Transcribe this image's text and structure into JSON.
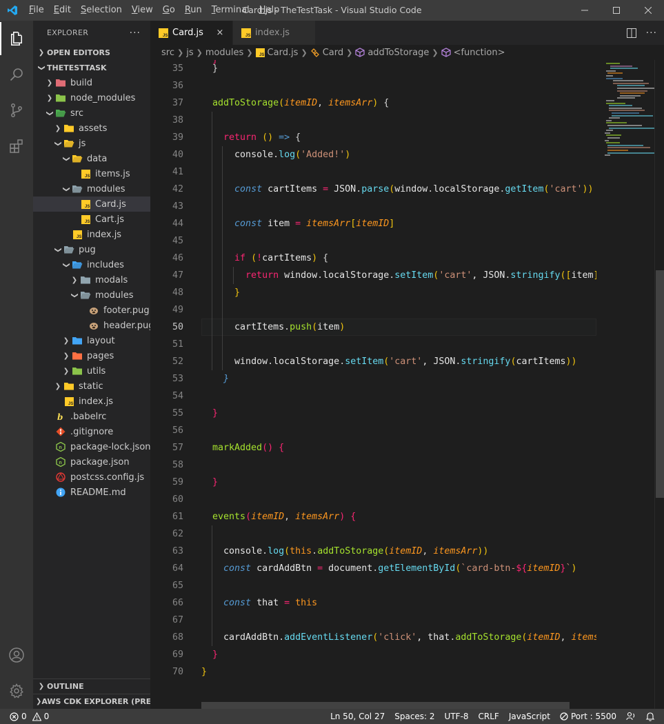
{
  "window": {
    "title": "Card.js - TheTestTask - Visual Studio Code",
    "menu": [
      {
        "pre": "",
        "u": "F",
        "post": "ile"
      },
      {
        "pre": "",
        "u": "E",
        "post": "dit"
      },
      {
        "pre": "",
        "u": "S",
        "post": "election"
      },
      {
        "pre": "",
        "u": "V",
        "post": "iew"
      },
      {
        "pre": "",
        "u": "G",
        "post": "o"
      },
      {
        "pre": "",
        "u": "R",
        "post": "un"
      },
      {
        "pre": "",
        "u": "T",
        "post": "erminal"
      },
      {
        "pre": "",
        "u": "H",
        "post": "elp"
      }
    ]
  },
  "sidebar": {
    "header": "EXPLORER",
    "open_editors": "OPEN EDITORS",
    "project": "THETESTTASK",
    "tree": [
      {
        "label": "build",
        "depth": 1,
        "twist": "closed",
        "icon": "folder-build-icon",
        "color": "#e06c75"
      },
      {
        "label": "node_modules",
        "depth": 1,
        "twist": "closed",
        "icon": "folder-node-icon",
        "color": "#8bc34a"
      },
      {
        "label": "src",
        "depth": 1,
        "twist": "open",
        "icon": "folder-src-icon",
        "color": "#4caf50"
      },
      {
        "label": "assets",
        "depth": 2,
        "twist": "closed",
        "icon": "folder-assets-icon",
        "color": "#ffca28"
      },
      {
        "label": "js",
        "depth": 2,
        "twist": "open",
        "icon": "folder-js-icon",
        "color": "#ffca28"
      },
      {
        "label": "data",
        "depth": 3,
        "twist": "open",
        "icon": "folder-data-icon",
        "color": "#ffca28"
      },
      {
        "label": "items.js",
        "depth": 4,
        "twist": "none",
        "icon": "js-file-icon",
        "color": "#ffca28"
      },
      {
        "label": "modules",
        "depth": 3,
        "twist": "open",
        "icon": "folder-modules-icon",
        "color": "#90a4ae"
      },
      {
        "label": "Card.js",
        "depth": 4,
        "twist": "none",
        "icon": "js-file-icon",
        "color": "#ffca28",
        "selected": true
      },
      {
        "label": "Cart.js",
        "depth": 4,
        "twist": "none",
        "icon": "js-file-icon",
        "color": "#ffca28"
      },
      {
        "label": "index.js",
        "depth": 3,
        "twist": "none",
        "icon": "js-file-icon",
        "color": "#ffca28"
      },
      {
        "label": "pug",
        "depth": 2,
        "twist": "open",
        "icon": "folder-pug-icon",
        "color": "#90a4ae"
      },
      {
        "label": "includes",
        "depth": 3,
        "twist": "open",
        "icon": "folder-includes-icon",
        "color": "#42a5f5"
      },
      {
        "label": "modals",
        "depth": 4,
        "twist": "closed",
        "icon": "folder-modals-icon",
        "color": "#90a4ae"
      },
      {
        "label": "modules",
        "depth": 4,
        "twist": "open",
        "icon": "folder-modules-icon",
        "color": "#90a4ae"
      },
      {
        "label": "footer.pug",
        "depth": 5,
        "twist": "none",
        "icon": "pug-file-icon",
        "color": "#c8a27a"
      },
      {
        "label": "header.pug",
        "depth": 5,
        "twist": "none",
        "icon": "pug-file-icon",
        "color": "#c8a27a"
      },
      {
        "label": "layout",
        "depth": 3,
        "twist": "closed",
        "icon": "folder-layout-icon",
        "color": "#42a5f5"
      },
      {
        "label": "pages",
        "depth": 3,
        "twist": "closed",
        "icon": "folder-pages-icon",
        "color": "#ff7043"
      },
      {
        "label": "utils",
        "depth": 3,
        "twist": "closed",
        "icon": "folder-utils-icon",
        "color": "#8bc34a"
      },
      {
        "label": "static",
        "depth": 2,
        "twist": "closed",
        "icon": "folder-static-icon",
        "color": "#ffca28"
      },
      {
        "label": "index.js",
        "depth": 2,
        "twist": "none",
        "icon": "js-file-icon",
        "color": "#ffca28"
      },
      {
        "label": ".babelrc",
        "depth": 1,
        "twist": "none",
        "icon": "babel-file-icon",
        "color": "#f5da55"
      },
      {
        "label": ".gitignore",
        "depth": 1,
        "twist": "none",
        "icon": "git-file-icon",
        "color": "#e44d26"
      },
      {
        "label": "package-lock.json",
        "depth": 1,
        "twist": "none",
        "icon": "npm-file-icon",
        "color": "#8bc34a"
      },
      {
        "label": "package.json",
        "depth": 1,
        "twist": "none",
        "icon": "npm-file-icon",
        "color": "#8bc34a"
      },
      {
        "label": "postcss.config.js",
        "depth": 1,
        "twist": "none",
        "icon": "postcss-file-icon",
        "color": "#e53935"
      },
      {
        "label": "README.md",
        "depth": 1,
        "twist": "none",
        "icon": "info-file-icon",
        "color": "#42a5f5"
      }
    ],
    "outline": "OUTLINE",
    "cdk": "AWS CDK EXPLORER (PRE..."
  },
  "tabs": [
    {
      "label": "Card.js",
      "active": true,
      "close": "×"
    },
    {
      "label": "index.js",
      "active": false,
      "close": ""
    }
  ],
  "breadcrumb": [
    "src",
    "js",
    "modules",
    "Card.js",
    "Card",
    "addToStorage",
    "<function>"
  ],
  "editor": {
    "current_line": 50,
    "partial_top_line": "}",
    "lines": [
      {
        "n": "35",
        "tokens": [
          {
            "t": "  ",
            "c": ""
          },
          {
            "t": "}",
            "c": "t-brace"
          }
        ]
      },
      {
        "n": "36",
        "tokens": []
      },
      {
        "n": "37",
        "tokens": [
          {
            "t": "  ",
            "c": ""
          },
          {
            "t": "addToStorage",
            "c": "t-fnname"
          },
          {
            "t": "(",
            "c": "t-paren"
          },
          {
            "t": "itemID",
            "c": "t-param"
          },
          {
            "t": ", ",
            "c": ""
          },
          {
            "t": "itemsArr",
            "c": "t-param"
          },
          {
            "t": ")",
            "c": "t-paren"
          },
          {
            "t": " {",
            "c": "t-brace"
          }
        ]
      },
      {
        "n": "38",
        "tokens": []
      },
      {
        "n": "39",
        "tokens": [
          {
            "t": "    ",
            "c": ""
          },
          {
            "t": "return",
            "c": "t-ret"
          },
          {
            "t": " () ",
            "c": "t-paren"
          },
          {
            "t": "=>",
            "c": "t-decl"
          },
          {
            "t": " {",
            "c": "t-brace"
          }
        ]
      },
      {
        "n": "40",
        "tokens": [
          {
            "t": "      ",
            "c": ""
          },
          {
            "t": "console",
            "c": "t-obj"
          },
          {
            "t": ".",
            "c": ""
          },
          {
            "t": "log",
            "c": "t-method"
          },
          {
            "t": "(",
            "c": "t-paren"
          },
          {
            "t": "'Added!'",
            "c": "t-str"
          },
          {
            "t": ")",
            "c": "t-paren"
          }
        ]
      },
      {
        "n": "41",
        "tokens": []
      },
      {
        "n": "42",
        "tokens": [
          {
            "t": "      ",
            "c": ""
          },
          {
            "t": "const",
            "c": "t-decl"
          },
          {
            "t": " cartItems ",
            "c": "t-var"
          },
          {
            "t": "=",
            "c": "t-op"
          },
          {
            "t": " JSON",
            "c": "t-obj"
          },
          {
            "t": ".",
            "c": ""
          },
          {
            "t": "parse",
            "c": "t-method"
          },
          {
            "t": "(",
            "c": "t-paren"
          },
          {
            "t": "window",
            "c": "t-obj"
          },
          {
            "t": ".",
            "c": ""
          },
          {
            "t": "localStorage",
            "c": "t-obj"
          },
          {
            "t": ".",
            "c": ""
          },
          {
            "t": "getItem",
            "c": "t-method"
          },
          {
            "t": "(",
            "c": "t-paren"
          },
          {
            "t": "'cart'",
            "c": "t-str"
          },
          {
            "t": "))",
            "c": "t-paren"
          }
        ]
      },
      {
        "n": "43",
        "tokens": []
      },
      {
        "n": "44",
        "tokens": [
          {
            "t": "      ",
            "c": ""
          },
          {
            "t": "const",
            "c": "t-decl"
          },
          {
            "t": " item ",
            "c": "t-var"
          },
          {
            "t": "=",
            "c": "t-op"
          },
          {
            "t": " ",
            "c": ""
          },
          {
            "t": "itemsArr",
            "c": "t-param"
          },
          {
            "t": "[",
            "c": "t-paren"
          },
          {
            "t": "itemID",
            "c": "t-param"
          },
          {
            "t": "]",
            "c": "t-paren"
          }
        ]
      },
      {
        "n": "45",
        "tokens": []
      },
      {
        "n": "46",
        "tokens": [
          {
            "t": "      ",
            "c": ""
          },
          {
            "t": "if",
            "c": "t-ret"
          },
          {
            "t": " (",
            "c": "t-paren"
          },
          {
            "t": "!",
            "c": "t-op"
          },
          {
            "t": "cartItems",
            "c": "t-var"
          },
          {
            "t": ")",
            "c": "t-paren"
          },
          {
            "t": " {",
            "c": "t-brace"
          }
        ]
      },
      {
        "n": "47",
        "tokens": [
          {
            "t": "        ",
            "c": ""
          },
          {
            "t": "return",
            "c": "t-ret"
          },
          {
            "t": " window",
            "c": "t-obj"
          },
          {
            "t": ".",
            "c": ""
          },
          {
            "t": "localStorage",
            "c": "t-obj"
          },
          {
            "t": ".",
            "c": ""
          },
          {
            "t": "setItem",
            "c": "t-method"
          },
          {
            "t": "(",
            "c": "t-paren"
          },
          {
            "t": "'cart'",
            "c": "t-str"
          },
          {
            "t": ", JSON",
            "c": "t-obj"
          },
          {
            "t": ".",
            "c": ""
          },
          {
            "t": "stringify",
            "c": "t-method"
          },
          {
            "t": "([",
            "c": "t-paren"
          },
          {
            "t": "item",
            "c": "t-var"
          },
          {
            "t": "]))",
            "c": "t-paren"
          }
        ]
      },
      {
        "n": "48",
        "tokens": [
          {
            "t": "      ",
            "c": ""
          },
          {
            "t": "}",
            "c": "t-paren"
          }
        ]
      },
      {
        "n": "49",
        "tokens": []
      },
      {
        "n": "50",
        "tokens": [
          {
            "t": "      ",
            "c": ""
          },
          {
            "t": "cartItems",
            "c": "t-var"
          },
          {
            "t": ".",
            "c": ""
          },
          {
            "t": "push",
            "c": "t-fnname"
          },
          {
            "t": "(",
            "c": "t-paren"
          },
          {
            "t": "item",
            "c": "t-var"
          },
          {
            "t": ")",
            "c": "t-paren"
          }
        ]
      },
      {
        "n": "51",
        "tokens": []
      },
      {
        "n": "52",
        "tokens": [
          {
            "t": "      ",
            "c": ""
          },
          {
            "t": "window",
            "c": "t-obj"
          },
          {
            "t": ".",
            "c": ""
          },
          {
            "t": "localStorage",
            "c": "t-obj"
          },
          {
            "t": ".",
            "c": ""
          },
          {
            "t": "setItem",
            "c": "t-method"
          },
          {
            "t": "(",
            "c": "t-paren"
          },
          {
            "t": "'cart'",
            "c": "t-str"
          },
          {
            "t": ", JSON",
            "c": "t-obj"
          },
          {
            "t": ".",
            "c": ""
          },
          {
            "t": "stringify",
            "c": "t-method"
          },
          {
            "t": "(",
            "c": "t-paren"
          },
          {
            "t": "cartItems",
            "c": "t-var"
          },
          {
            "t": "))",
            "c": "t-paren"
          }
        ]
      },
      {
        "n": "53",
        "tokens": [
          {
            "t": "    ",
            "c": ""
          },
          {
            "t": "}",
            "c": "t-decl"
          }
        ]
      },
      {
        "n": "54",
        "tokens": []
      },
      {
        "n": "55",
        "tokens": [
          {
            "t": "  ",
            "c": ""
          },
          {
            "t": "}",
            "c": "t-op"
          }
        ]
      },
      {
        "n": "56",
        "tokens": []
      },
      {
        "n": "57",
        "tokens": [
          {
            "t": "  ",
            "c": ""
          },
          {
            "t": "markAdded",
            "c": "t-fnname"
          },
          {
            "t": "() {",
            "c": "t-op"
          }
        ]
      },
      {
        "n": "58",
        "tokens": []
      },
      {
        "n": "59",
        "tokens": [
          {
            "t": "  ",
            "c": ""
          },
          {
            "t": "}",
            "c": "t-op"
          }
        ]
      },
      {
        "n": "60",
        "tokens": []
      },
      {
        "n": "61",
        "tokens": [
          {
            "t": "  ",
            "c": ""
          },
          {
            "t": "events",
            "c": "t-fnname"
          },
          {
            "t": "(",
            "c": "t-op"
          },
          {
            "t": "itemID",
            "c": "t-param"
          },
          {
            "t": ", ",
            "c": ""
          },
          {
            "t": "itemsArr",
            "c": "t-param"
          },
          {
            "t": ") {",
            "c": "t-op"
          }
        ]
      },
      {
        "n": "62",
        "tokens": []
      },
      {
        "n": "63",
        "tokens": [
          {
            "t": "    ",
            "c": ""
          },
          {
            "t": "console",
            "c": "t-obj"
          },
          {
            "t": ".",
            "c": ""
          },
          {
            "t": "log",
            "c": "t-method"
          },
          {
            "t": "(",
            "c": "t-paren"
          },
          {
            "t": "this",
            "c": "t-this"
          },
          {
            "t": ".",
            "c": ""
          },
          {
            "t": "addToStorage",
            "c": "t-fnname"
          },
          {
            "t": "(",
            "c": "t-paren"
          },
          {
            "t": "itemID",
            "c": "t-param"
          },
          {
            "t": ", ",
            "c": ""
          },
          {
            "t": "itemsArr",
            "c": "t-param"
          },
          {
            "t": "))",
            "c": "t-paren"
          }
        ]
      },
      {
        "n": "64",
        "tokens": [
          {
            "t": "    ",
            "c": ""
          },
          {
            "t": "const",
            "c": "t-decl"
          },
          {
            "t": " cardAddBtn ",
            "c": "t-var"
          },
          {
            "t": "=",
            "c": "t-op"
          },
          {
            "t": " document",
            "c": "t-obj"
          },
          {
            "t": ".",
            "c": ""
          },
          {
            "t": "getElementById",
            "c": "t-method"
          },
          {
            "t": "(",
            "c": "t-paren"
          },
          {
            "t": "`card-btn-",
            "c": "t-str"
          },
          {
            "t": "${",
            "c": "t-op"
          },
          {
            "t": "itemID",
            "c": "t-param"
          },
          {
            "t": "}",
            "c": "t-op"
          },
          {
            "t": "`",
            "c": "t-str"
          },
          {
            "t": ")",
            "c": "t-paren"
          }
        ]
      },
      {
        "n": "65",
        "tokens": []
      },
      {
        "n": "66",
        "tokens": [
          {
            "t": "    ",
            "c": ""
          },
          {
            "t": "const",
            "c": "t-decl"
          },
          {
            "t": " that ",
            "c": "t-var"
          },
          {
            "t": "=",
            "c": "t-op"
          },
          {
            "t": " ",
            "c": ""
          },
          {
            "t": "this",
            "c": "t-this"
          }
        ]
      },
      {
        "n": "67",
        "tokens": []
      },
      {
        "n": "68",
        "tokens": [
          {
            "t": "    ",
            "c": ""
          },
          {
            "t": "cardAddBtn",
            "c": "t-var"
          },
          {
            "t": ".",
            "c": ""
          },
          {
            "t": "addEventListener",
            "c": "t-method"
          },
          {
            "t": "(",
            "c": "t-paren"
          },
          {
            "t": "'click'",
            "c": "t-str"
          },
          {
            "t": ", that",
            "c": "t-var"
          },
          {
            "t": ".",
            "c": ""
          },
          {
            "t": "addToStorage",
            "c": "t-fnname"
          },
          {
            "t": "(",
            "c": "t-paren"
          },
          {
            "t": "itemID",
            "c": "t-param"
          },
          {
            "t": ", ",
            "c": ""
          },
          {
            "t": "itemsArr",
            "c": "t-param"
          }
        ]
      },
      {
        "n": "69",
        "tokens": [
          {
            "t": "  ",
            "c": ""
          },
          {
            "t": "}",
            "c": "t-op"
          }
        ]
      },
      {
        "n": "70",
        "tokens": [
          {
            "t": "}",
            "c": "t-paren"
          }
        ]
      }
    ]
  },
  "statusbar": {
    "errors": "0",
    "warnings": "0",
    "position": "Ln 50, Col 27",
    "spaces": "Spaces: 2",
    "encoding": "UTF-8",
    "eol": "CRLF",
    "language": "JavaScript",
    "port": "Port : 5500"
  },
  "colors": {
    "accent_blue": "#007acc",
    "statusbar": "#3c3c3c",
    "editor_bg": "#1e1e1e",
    "sidebar_bg": "#252526"
  }
}
